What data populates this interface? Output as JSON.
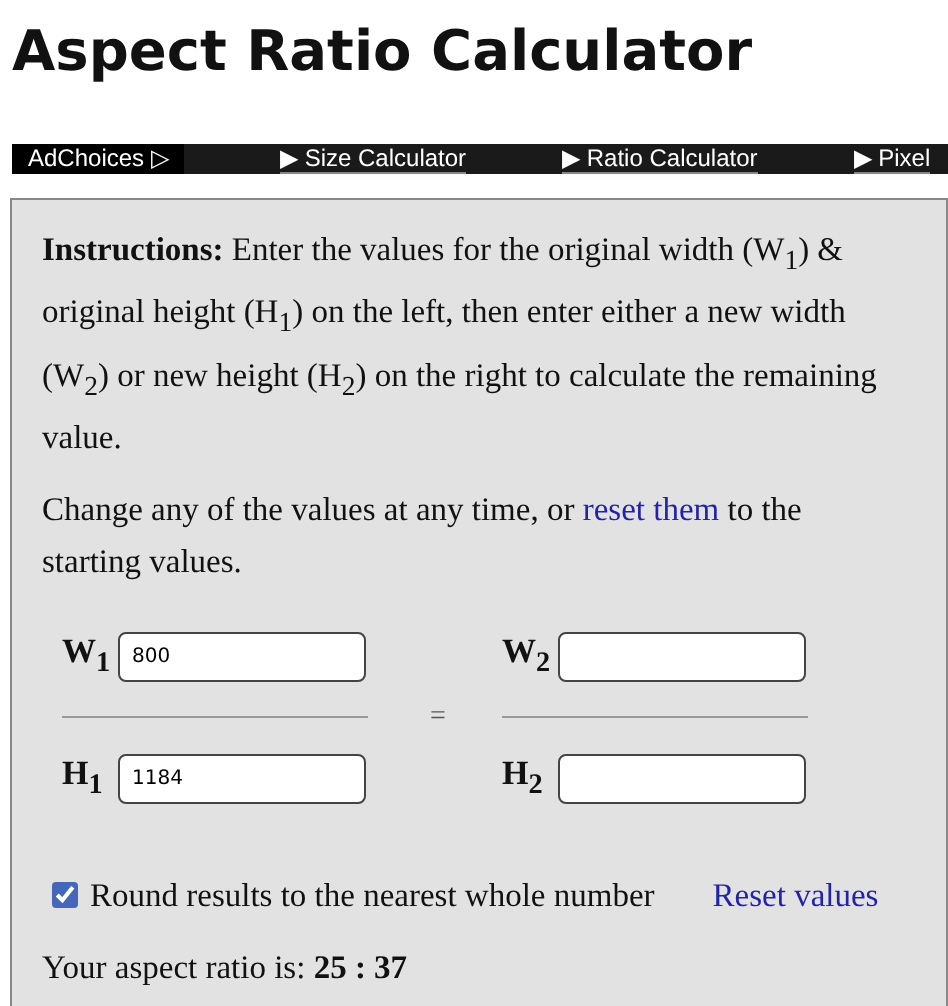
{
  "title": "Aspect Ratio Calculator",
  "nav": [
    {
      "kind": "ad",
      "label": "AdChoices ▷"
    },
    {
      "kind": "link",
      "label": "▶ Size Calculator"
    },
    {
      "kind": "link",
      "label": "▶ Ratio Calculator"
    },
    {
      "kind": "link",
      "label": "▶ Pixel"
    }
  ],
  "instructions": "**Instructions:** Enter the values for the original width (W$_{1}$) & original height (H$_{1}$) on the left, then enter either a new width (W$_{2}$) or new height (H$_{2}$) on the right to calculate the remaining value.",
  "change_note": {
    "before": "Change any of the values at any time, or ",
    "link": "reset them",
    "after": " to the starting values."
  },
  "fields": [
    {
      "label": "W$_{1}$",
      "value": "800"
    },
    {
      "label": "W$_{2}$"
    },
    {
      "label": "H$_{1}$",
      "value": "1184"
    },
    {
      "label": "H$_{2}$"
    }
  ],
  "equals": "=",
  "round": {
    "label": "Round results to the nearest whole number",
    "checked": true
  },
  "reset_link": "Reset values",
  "result": {
    "label": "Your aspect ratio is:",
    "value": "25 : 37"
  }
}
